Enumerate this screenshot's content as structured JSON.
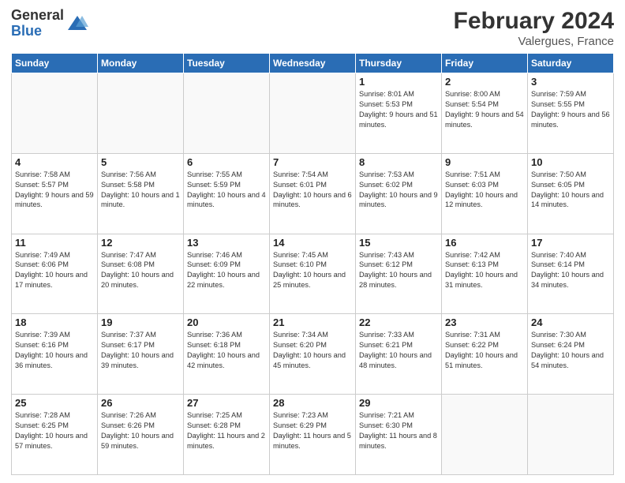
{
  "header": {
    "logo_general": "General",
    "logo_blue": "Blue",
    "title": "February 2024",
    "subtitle": "Valergues, France"
  },
  "days_of_week": [
    "Sunday",
    "Monday",
    "Tuesday",
    "Wednesday",
    "Thursday",
    "Friday",
    "Saturday"
  ],
  "weeks": [
    [
      {
        "num": "",
        "info": ""
      },
      {
        "num": "",
        "info": ""
      },
      {
        "num": "",
        "info": ""
      },
      {
        "num": "",
        "info": ""
      },
      {
        "num": "1",
        "info": "Sunrise: 8:01 AM\nSunset: 5:53 PM\nDaylight: 9 hours and 51 minutes."
      },
      {
        "num": "2",
        "info": "Sunrise: 8:00 AM\nSunset: 5:54 PM\nDaylight: 9 hours and 54 minutes."
      },
      {
        "num": "3",
        "info": "Sunrise: 7:59 AM\nSunset: 5:55 PM\nDaylight: 9 hours and 56 minutes."
      }
    ],
    [
      {
        "num": "4",
        "info": "Sunrise: 7:58 AM\nSunset: 5:57 PM\nDaylight: 9 hours and 59 minutes."
      },
      {
        "num": "5",
        "info": "Sunrise: 7:56 AM\nSunset: 5:58 PM\nDaylight: 10 hours and 1 minute."
      },
      {
        "num": "6",
        "info": "Sunrise: 7:55 AM\nSunset: 5:59 PM\nDaylight: 10 hours and 4 minutes."
      },
      {
        "num": "7",
        "info": "Sunrise: 7:54 AM\nSunset: 6:01 PM\nDaylight: 10 hours and 6 minutes."
      },
      {
        "num": "8",
        "info": "Sunrise: 7:53 AM\nSunset: 6:02 PM\nDaylight: 10 hours and 9 minutes."
      },
      {
        "num": "9",
        "info": "Sunrise: 7:51 AM\nSunset: 6:03 PM\nDaylight: 10 hours and 12 minutes."
      },
      {
        "num": "10",
        "info": "Sunrise: 7:50 AM\nSunset: 6:05 PM\nDaylight: 10 hours and 14 minutes."
      }
    ],
    [
      {
        "num": "11",
        "info": "Sunrise: 7:49 AM\nSunset: 6:06 PM\nDaylight: 10 hours and 17 minutes."
      },
      {
        "num": "12",
        "info": "Sunrise: 7:47 AM\nSunset: 6:08 PM\nDaylight: 10 hours and 20 minutes."
      },
      {
        "num": "13",
        "info": "Sunrise: 7:46 AM\nSunset: 6:09 PM\nDaylight: 10 hours and 22 minutes."
      },
      {
        "num": "14",
        "info": "Sunrise: 7:45 AM\nSunset: 6:10 PM\nDaylight: 10 hours and 25 minutes."
      },
      {
        "num": "15",
        "info": "Sunrise: 7:43 AM\nSunset: 6:12 PM\nDaylight: 10 hours and 28 minutes."
      },
      {
        "num": "16",
        "info": "Sunrise: 7:42 AM\nSunset: 6:13 PM\nDaylight: 10 hours and 31 minutes."
      },
      {
        "num": "17",
        "info": "Sunrise: 7:40 AM\nSunset: 6:14 PM\nDaylight: 10 hours and 34 minutes."
      }
    ],
    [
      {
        "num": "18",
        "info": "Sunrise: 7:39 AM\nSunset: 6:16 PM\nDaylight: 10 hours and 36 minutes."
      },
      {
        "num": "19",
        "info": "Sunrise: 7:37 AM\nSunset: 6:17 PM\nDaylight: 10 hours and 39 minutes."
      },
      {
        "num": "20",
        "info": "Sunrise: 7:36 AM\nSunset: 6:18 PM\nDaylight: 10 hours and 42 minutes."
      },
      {
        "num": "21",
        "info": "Sunrise: 7:34 AM\nSunset: 6:20 PM\nDaylight: 10 hours and 45 minutes."
      },
      {
        "num": "22",
        "info": "Sunrise: 7:33 AM\nSunset: 6:21 PM\nDaylight: 10 hours and 48 minutes."
      },
      {
        "num": "23",
        "info": "Sunrise: 7:31 AM\nSunset: 6:22 PM\nDaylight: 10 hours and 51 minutes."
      },
      {
        "num": "24",
        "info": "Sunrise: 7:30 AM\nSunset: 6:24 PM\nDaylight: 10 hours and 54 minutes."
      }
    ],
    [
      {
        "num": "25",
        "info": "Sunrise: 7:28 AM\nSunset: 6:25 PM\nDaylight: 10 hours and 57 minutes."
      },
      {
        "num": "26",
        "info": "Sunrise: 7:26 AM\nSunset: 6:26 PM\nDaylight: 10 hours and 59 minutes."
      },
      {
        "num": "27",
        "info": "Sunrise: 7:25 AM\nSunset: 6:28 PM\nDaylight: 11 hours and 2 minutes."
      },
      {
        "num": "28",
        "info": "Sunrise: 7:23 AM\nSunset: 6:29 PM\nDaylight: 11 hours and 5 minutes."
      },
      {
        "num": "29",
        "info": "Sunrise: 7:21 AM\nSunset: 6:30 PM\nDaylight: 11 hours and 8 minutes."
      },
      {
        "num": "",
        "info": ""
      },
      {
        "num": "",
        "info": ""
      }
    ]
  ]
}
